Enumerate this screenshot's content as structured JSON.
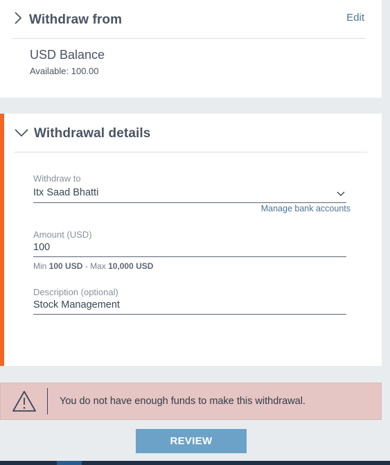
{
  "withdraw_from": {
    "title": "Withdraw from",
    "edit_label": "Edit",
    "balance_name": "USD Balance",
    "available": "Available: 100.00"
  },
  "details": {
    "title": "Withdrawal details",
    "withdraw_to": {
      "label": "Withdraw to",
      "value": "Itx Saad Bhatti",
      "manage_link": "Manage bank accounts"
    },
    "amount": {
      "label": "Amount (USD)",
      "value": "100",
      "hint_min_prefix": "Min",
      "hint_min": "100 USD",
      "hint_sep": "- Max",
      "hint_max": "10,000 USD"
    },
    "description": {
      "label": "Description (optional)",
      "value": "Stock Management"
    }
  },
  "alert": {
    "icon": "warning-icon",
    "message": "You do not have enough funds to make this withdrawal."
  },
  "review_button": "REVIEW",
  "colors": {
    "accent": "#f26522",
    "link": "#4d7596",
    "button": "#6ca2c8",
    "alert_bg": "#e6c5c5"
  }
}
